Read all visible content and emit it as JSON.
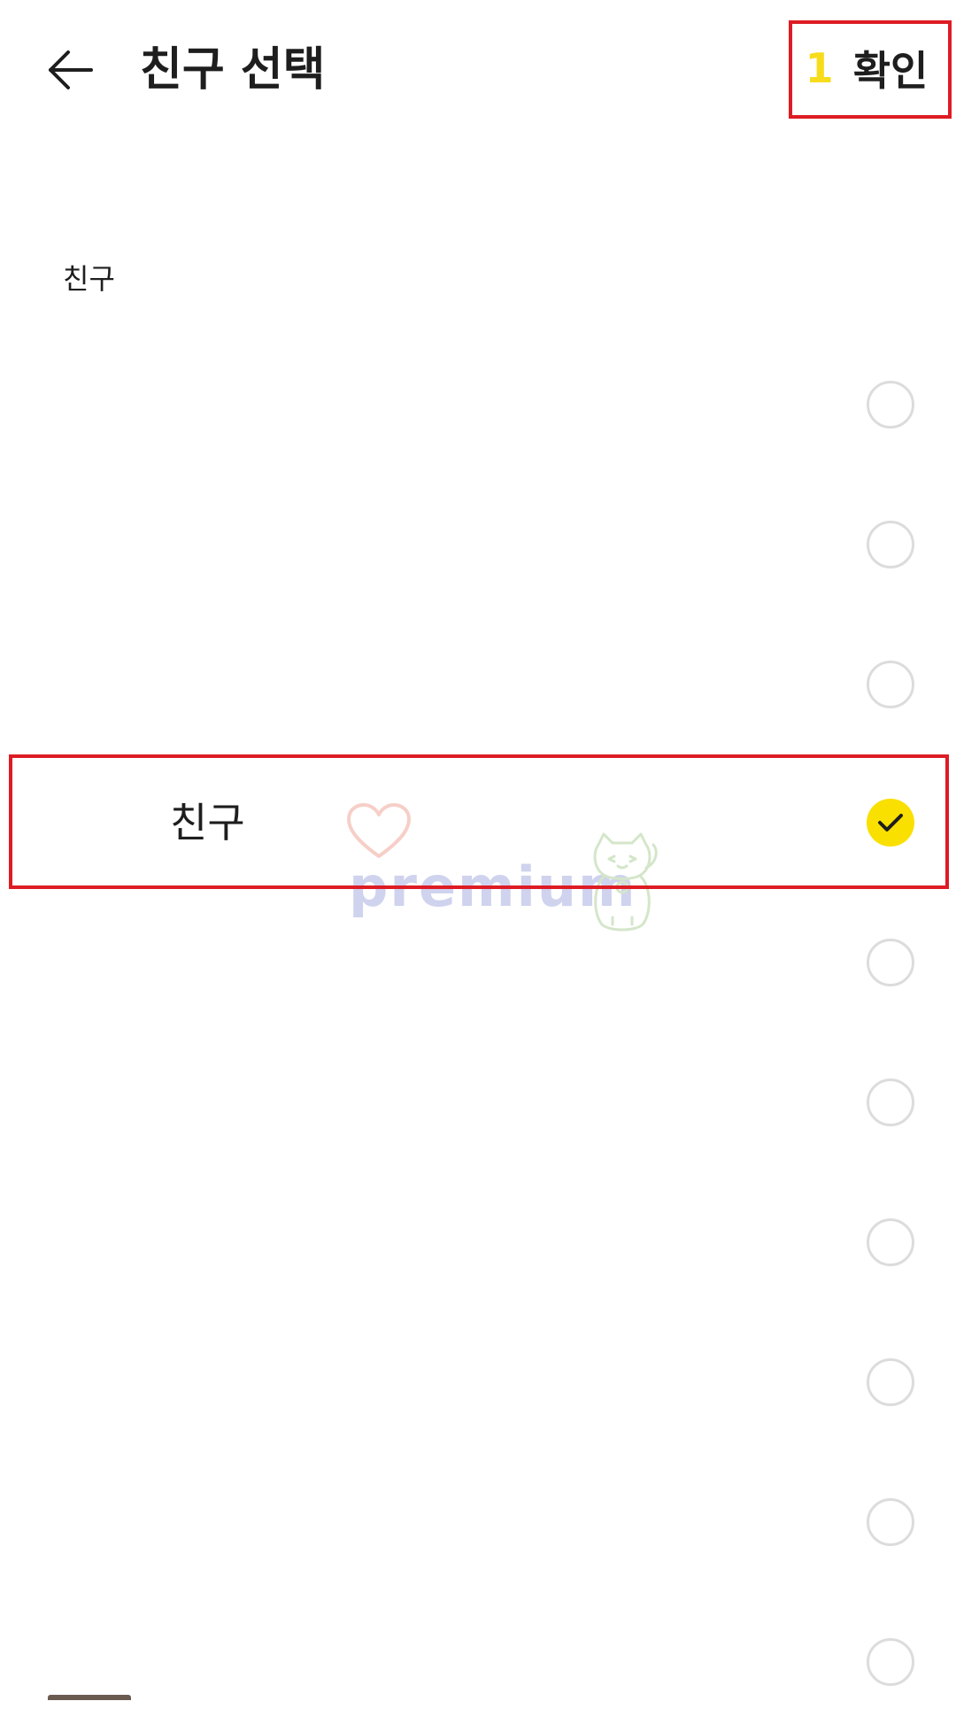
{
  "header": {
    "title": "친구 선택",
    "confirm_count": "1",
    "confirm_label": "확인"
  },
  "section": {
    "label": "친구"
  },
  "friends": [
    {
      "name": "",
      "selected": false
    },
    {
      "name": "",
      "selected": false
    },
    {
      "name": "",
      "selected": false
    },
    {
      "name": "친구",
      "selected": true
    },
    {
      "name": "",
      "selected": false
    },
    {
      "name": "",
      "selected": false
    },
    {
      "name": "",
      "selected": false
    },
    {
      "name": "",
      "selected": false
    },
    {
      "name": "",
      "selected": false
    },
    {
      "name": "",
      "selected": false
    }
  ],
  "watermark": {
    "text": "premium"
  },
  "colors": {
    "accent_yellow": "#f9e000",
    "count_yellow": "#f7dc1c",
    "highlight_red": "#dd1c24",
    "radio_border": "#dcdcdc",
    "text": "#1e1e1e"
  },
  "icons": {
    "back": "arrow-left-icon",
    "checked": "check-icon"
  }
}
